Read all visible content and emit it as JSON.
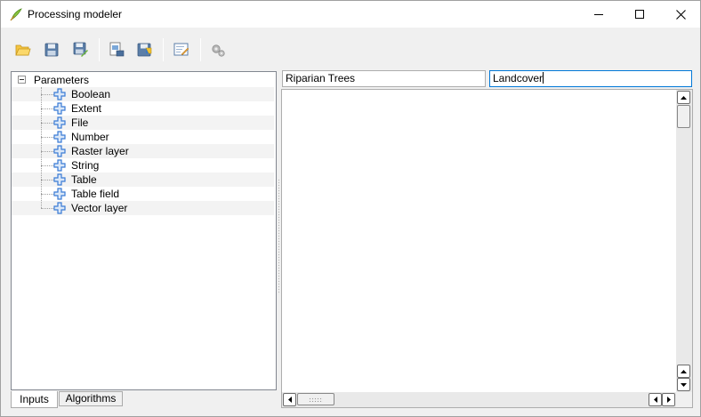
{
  "window": {
    "title": "Processing modeler",
    "controls": [
      "minimize-icon",
      "maximize-icon",
      "close-icon"
    ]
  },
  "toolbar": {
    "buttons": [
      {
        "icon": "open-folder-icon"
      },
      {
        "icon": "save-icon"
      },
      {
        "icon": "save-as-icon"
      },
      {
        "icon": "export-image-icon"
      },
      {
        "icon": "export-python-icon"
      },
      {
        "icon": "edit-help-icon"
      },
      {
        "icon": "run-model-icon"
      }
    ]
  },
  "tree": {
    "root": "Parameters",
    "items": [
      {
        "label": "Boolean"
      },
      {
        "label": "Extent"
      },
      {
        "label": "File"
      },
      {
        "label": "Number"
      },
      {
        "label": "Raster layer"
      },
      {
        "label": "String"
      },
      {
        "label": "Table"
      },
      {
        "label": "Table field"
      },
      {
        "label": "Vector layer"
      }
    ]
  },
  "tabs": {
    "inputs": "Inputs",
    "algorithms": "Algorithms",
    "active": "Inputs"
  },
  "model": {
    "name_value": "Riparian Trees",
    "group_value": "Landcover"
  },
  "colors": {
    "plus_icon": "#3a7bd5",
    "focus_border": "#0078d7"
  }
}
